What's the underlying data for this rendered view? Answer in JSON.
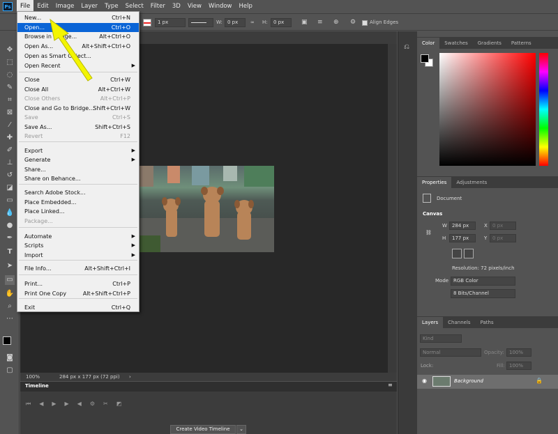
{
  "menubar": {
    "logo": "Ps",
    "items": [
      "File",
      "Edit",
      "Image",
      "Layer",
      "Type",
      "Select",
      "Filter",
      "3D",
      "View",
      "Window",
      "Help"
    ]
  },
  "options": {
    "stroke_size": "1 px",
    "w_label": "W:",
    "w_value": "0 px",
    "h_label": "H:",
    "h_value": "0 px",
    "align_edges": "Align Edges"
  },
  "file_menu": {
    "items": [
      {
        "label": "New...",
        "shortcut": "Ctrl+N",
        "state": "normal"
      },
      {
        "label": "Open...",
        "shortcut": "Ctrl+O",
        "state": "highlight"
      },
      {
        "label": "Browse in Bridge...",
        "shortcut": "Alt+Ctrl+O",
        "state": "normal"
      },
      {
        "label": "Open As...",
        "shortcut": "Alt+Shift+Ctrl+O",
        "state": "normal"
      },
      {
        "label": "Open as Smart Object...",
        "shortcut": "",
        "state": "normal"
      },
      {
        "label": "Open Recent",
        "shortcut": "",
        "state": "submenu"
      },
      {
        "label": "Close",
        "shortcut": "Ctrl+W",
        "state": "normal"
      },
      {
        "label": "Close All",
        "shortcut": "Alt+Ctrl+W",
        "state": "normal"
      },
      {
        "label": "Close Others",
        "shortcut": "Alt+Ctrl+P",
        "state": "disabled"
      },
      {
        "label": "Close and Go to Bridge...",
        "shortcut": "Shift+Ctrl+W",
        "state": "normal"
      },
      {
        "label": "Save",
        "shortcut": "Ctrl+S",
        "state": "disabled"
      },
      {
        "label": "Save As...",
        "shortcut": "Shift+Ctrl+S",
        "state": "normal"
      },
      {
        "label": "Revert",
        "shortcut": "F12",
        "state": "disabled"
      },
      {
        "label": "Export",
        "shortcut": "",
        "state": "submenu"
      },
      {
        "label": "Generate",
        "shortcut": "",
        "state": "submenu"
      },
      {
        "label": "Share...",
        "shortcut": "",
        "state": "normal"
      },
      {
        "label": "Share on Behance...",
        "shortcut": "",
        "state": "normal"
      },
      {
        "label": "Search Adobe Stock...",
        "shortcut": "",
        "state": "normal"
      },
      {
        "label": "Place Embedded...",
        "shortcut": "",
        "state": "normal"
      },
      {
        "label": "Place Linked...",
        "shortcut": "",
        "state": "normal"
      },
      {
        "label": "Package...",
        "shortcut": "",
        "state": "disabled"
      },
      {
        "label": "Automate",
        "shortcut": "",
        "state": "submenu"
      },
      {
        "label": "Scripts",
        "shortcut": "",
        "state": "submenu"
      },
      {
        "label": "Import",
        "shortcut": "",
        "state": "submenu"
      },
      {
        "label": "File Info...",
        "shortcut": "Alt+Shift+Ctrl+I",
        "state": "normal"
      },
      {
        "label": "Print...",
        "shortcut": "Ctrl+P",
        "state": "normal"
      },
      {
        "label": "Print One Copy",
        "shortcut": "Alt+Shift+Ctrl+P",
        "state": "normal"
      },
      {
        "label": "Exit",
        "shortcut": "Ctrl+Q",
        "state": "normal"
      }
    ]
  },
  "status": {
    "zoom": "100%",
    "doc_info": "284 px x 177 px (72 ppi)"
  },
  "timeline": {
    "title": "Timeline",
    "create_button": "Create Video Timeline"
  },
  "color_panel": {
    "tabs": [
      "Color",
      "Swatches",
      "Gradients",
      "Patterns"
    ]
  },
  "properties_panel": {
    "tabs": [
      "Properties",
      "Adjustments"
    ],
    "document_label": "Document",
    "section": "Canvas",
    "w_label": "W",
    "w_value": "284 px",
    "x_label": "X",
    "x_placeholder": "0 px",
    "h_label": "H",
    "h_value": "177 px",
    "y_label": "Y",
    "y_placeholder": "0 px",
    "resolution": "Resolution: 72 pixels/inch",
    "mode_label": "Mode",
    "mode_value": "RGB Color",
    "bits_value": "8 Bits/Channel"
  },
  "layers_panel": {
    "tabs": [
      "Layers",
      "Channels",
      "Paths"
    ],
    "kind": "Kind",
    "blend": "Normal",
    "opacity_label": "Opacity:",
    "opacity_value": "100%",
    "lock_label": "Lock:",
    "fill_label": "Fill:",
    "fill_value": "100%",
    "layer_name": "Background"
  },
  "colors": {
    "accent": "#0a64d6",
    "arrow": "#f3f500"
  }
}
